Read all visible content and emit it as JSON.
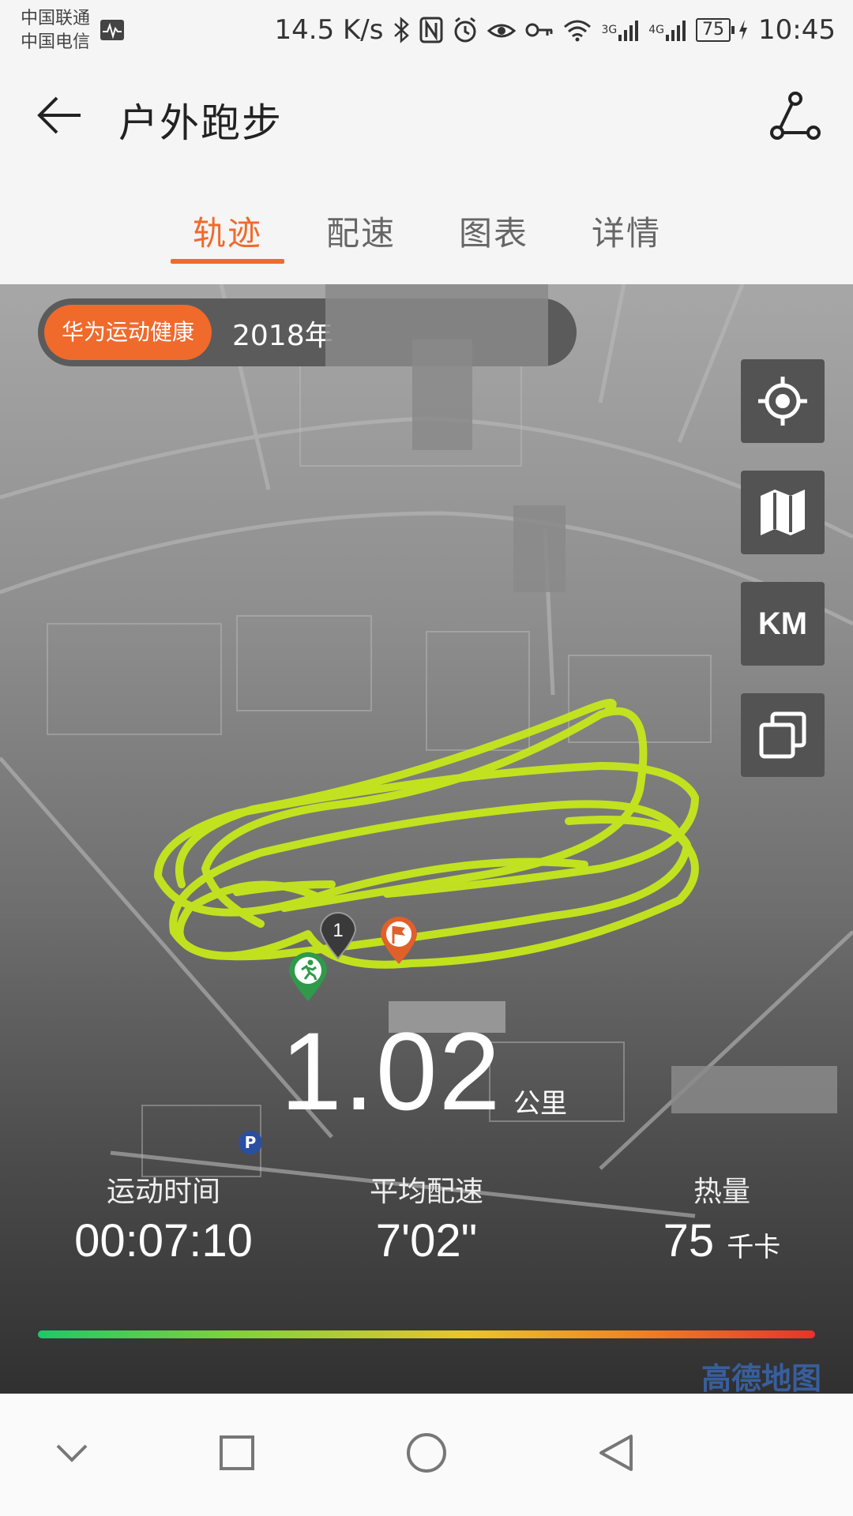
{
  "status_bar": {
    "carrier_1": "中国联通",
    "carrier_2": "中国电信",
    "net_speed": "14.5 K/s",
    "signal_1": "3G",
    "signal_2": "4G",
    "battery": "75",
    "time": "10:45"
  },
  "header": {
    "title": "户外跑步"
  },
  "tabs": [
    {
      "label": "轨迹",
      "active": true
    },
    {
      "label": "配速",
      "active": false
    },
    {
      "label": "图表",
      "active": false
    },
    {
      "label": "详情",
      "active": false
    }
  ],
  "map": {
    "app_badge": "华为运动健康",
    "date_prefix": "2018年",
    "km_button": "KM",
    "lap_marker": "1",
    "logo": "高德地图"
  },
  "summary": {
    "distance": "1.02",
    "distance_unit": "公里",
    "stats": [
      {
        "label": "运动时间",
        "value": "00:07:10",
        "unit": ""
      },
      {
        "label": "平均配速",
        "value": "7'02\"",
        "unit": ""
      },
      {
        "label": "热量",
        "value": "75",
        "unit": "千卡"
      }
    ]
  },
  "colors": {
    "accent": "#f06a2c",
    "track": "#c6e81c",
    "start_pin": "#2e9a4a",
    "finish_pin": "#e0602a"
  },
  "icons": [
    "back-arrow-icon",
    "route-icon",
    "locate-icon",
    "map-icon",
    "layers-icon",
    "nav-down-icon",
    "nav-recent-icon",
    "nav-home-icon",
    "nav-back-icon"
  ]
}
